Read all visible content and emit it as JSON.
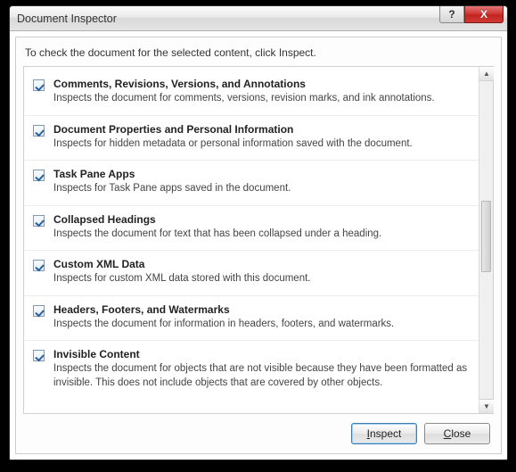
{
  "window": {
    "title": "Document Inspector",
    "help_label": "?",
    "close_label": "X"
  },
  "instruction": "To check the document for the selected content, click Inspect.",
  "items": [
    {
      "checked": true,
      "title": "Comments, Revisions, Versions, and Annotations",
      "desc": "Inspects the document for comments, versions, revision marks, and ink annotations."
    },
    {
      "checked": true,
      "title": "Document Properties and Personal Information",
      "desc": "Inspects for hidden metadata or personal information saved with the document."
    },
    {
      "checked": true,
      "title": "Task Pane Apps",
      "desc": "Inspects for Task Pane apps saved in the document."
    },
    {
      "checked": true,
      "title": "Collapsed Headings",
      "desc": "Inspects the document for text that has been collapsed under a heading."
    },
    {
      "checked": true,
      "title": "Custom XML Data",
      "desc": "Inspects for custom XML data stored with this document."
    },
    {
      "checked": true,
      "title": "Headers, Footers, and Watermarks",
      "desc": "Inspects the document for information in headers, footers, and watermarks."
    },
    {
      "checked": true,
      "title": "Invisible Content",
      "desc": "Inspects the document for objects that are not visible because they have been formatted as invisible. This does not include objects that are covered by other objects."
    }
  ],
  "buttons": {
    "inspect": {
      "accesskey": "I",
      "rest": "nspect"
    },
    "close": {
      "accesskey": "C",
      "rest": "lose"
    }
  }
}
